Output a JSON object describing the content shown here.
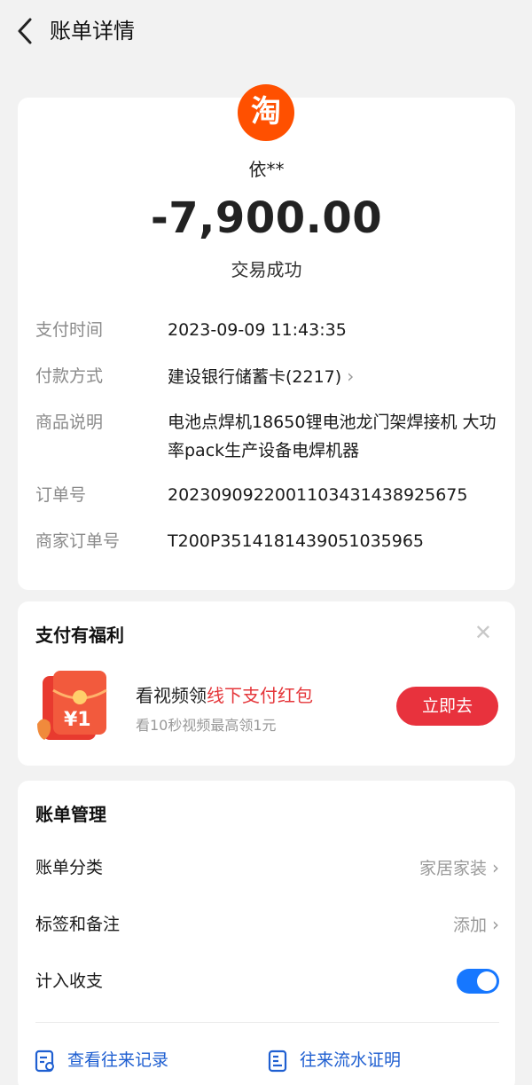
{
  "header": {
    "title": "账单详情"
  },
  "merchant": {
    "logo_text": "淘",
    "name": "依**",
    "amount": "-7,900.00",
    "status": "交易成功"
  },
  "details": [
    {
      "label": "支付时间",
      "value": "2023-09-09 11:43:35"
    },
    {
      "label": "付款方式",
      "value": "建设银行储蓄卡(2217)"
    },
    {
      "label": "商品说明",
      "value": "电池点焊机18650锂电池龙门架焊接机 大功率pack生产设备电焊机器"
    },
    {
      "label": "订单号",
      "value": "2023090922001103431438925675"
    },
    {
      "label": "商家订单号",
      "value": "T200P3514181439051035965"
    }
  ],
  "benefit": {
    "title": "支付有福利",
    "offer_prefix": "看视频领",
    "offer_highlight": "线下支付红包",
    "offer_sub": "看10秒视频最高领1元",
    "button": "立即去",
    "packet_text": "¥1"
  },
  "manage": {
    "title": "账单管理",
    "category_label": "账单分类",
    "category_value": "家居家装",
    "tags_label": "标签和备注",
    "tags_value": "添加",
    "include_label": "计入收支",
    "include_on": true,
    "links": [
      "查看往来记录",
      "往来流水证明"
    ]
  },
  "colors": {
    "accent_blue": "#1677ff",
    "red_button": "#e8323d",
    "taobao_orange": "#ff5000"
  },
  "icons": [
    "back-icon",
    "taobao-logo-icon",
    "chevron-right-icon",
    "close-icon",
    "red-packet-icon",
    "records-icon",
    "statement-icon"
  ]
}
